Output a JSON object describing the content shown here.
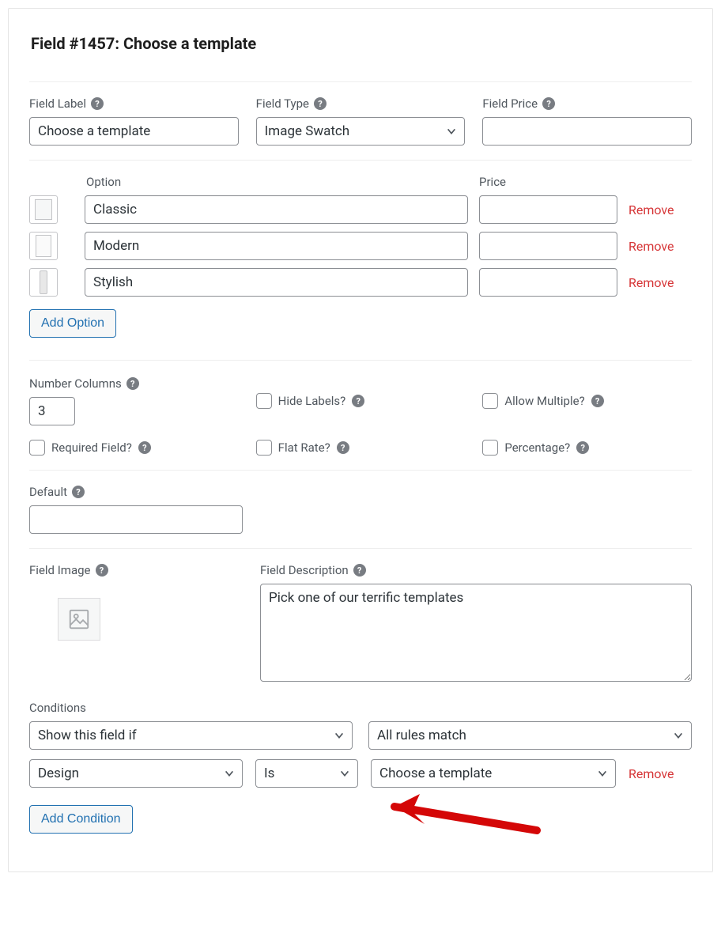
{
  "title": "Field #1457: Choose a template",
  "labels": {
    "field_label": "Field Label",
    "field_type": "Field Type",
    "field_price": "Field Price",
    "option": "Option",
    "price": "Price",
    "remove": "Remove",
    "add_option": "Add Option",
    "number_columns": "Number Columns",
    "hide_labels": "Hide Labels?",
    "allow_multiple": "Allow Multiple?",
    "required_field": "Required Field?",
    "flat_rate": "Flat Rate?",
    "percentage": "Percentage?",
    "default": "Default",
    "field_image": "Field Image",
    "field_description": "Field Description",
    "conditions": "Conditions",
    "add_condition": "Add Condition"
  },
  "values": {
    "field_label": "Choose a template",
    "field_type": "Image Swatch",
    "field_price": "",
    "number_columns": "3",
    "default": "",
    "field_description": "Pick one of our terrific templates"
  },
  "options": [
    {
      "name": "Classic",
      "price": ""
    },
    {
      "name": "Modern",
      "price": ""
    },
    {
      "name": "Stylish",
      "price": ""
    }
  ],
  "checks": {
    "hide_labels": false,
    "allow_multiple": false,
    "required_field": false,
    "flat_rate": false,
    "percentage": false
  },
  "conditions": {
    "visibility": "Show this field if",
    "match": "All rules match",
    "rules": [
      {
        "field": "Design",
        "op": "Is",
        "value": "Choose a template"
      }
    ]
  }
}
